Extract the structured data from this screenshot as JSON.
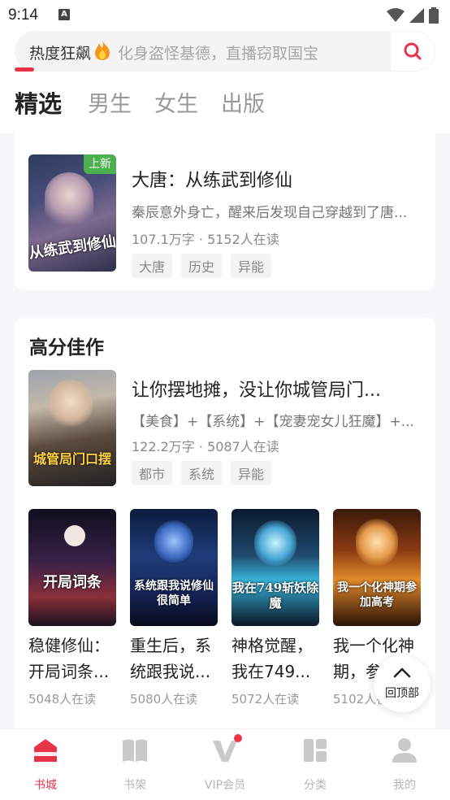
{
  "status": {
    "time": "9:14",
    "notification_letter": "A"
  },
  "search": {
    "hot_label": "热度狂飙",
    "hint": "化身盗怪基德，直播窃取国宝"
  },
  "tabs": [
    {
      "label": "精选",
      "active": true
    },
    {
      "label": "男生",
      "active": false
    },
    {
      "label": "女生",
      "active": false
    },
    {
      "label": "出版",
      "active": false
    }
  ],
  "featured_book": {
    "badge": "上新",
    "cover_text": "从练武到修仙",
    "title": "大唐：从练武到修仙",
    "desc": "秦辰意外身亡，醒来后发现自己穿越到了唐...",
    "meta": "107.1万字 · 5152人在读",
    "tags": [
      "大唐",
      "历史",
      "异能"
    ]
  },
  "high_score": {
    "section_title": "高分佳作",
    "lead_book": {
      "cover_text": "城管局门口摆",
      "title": "让你摆地摊，没让你城管局门...",
      "desc": "【美食】+【系统】+【宠妻宠女儿狂魔】+...",
      "meta": "122.2万字 · 5087人在读",
      "tags": [
        "都市",
        "系统",
        "异能"
      ]
    },
    "grid": [
      {
        "cover_text": "开局词条",
        "title": "稳健修仙：开局词条...",
        "meta": "5048人在读"
      },
      {
        "cover_text": "系统跟我说修仙很简单",
        "title": "重生后，系统跟我说...",
        "meta": "5080人在读"
      },
      {
        "cover_text": "我在749斩妖除魔",
        "title": "神格觉醒，我在749...",
        "meta": "5072人在读"
      },
      {
        "cover_text": "我一个化神期参加高考",
        "title": "我一个化神期，参加...",
        "meta": "5102人在读"
      }
    ]
  },
  "back_to_top": "回顶部",
  "bottom_nav": [
    {
      "label": "书城",
      "icon": "bookstore-icon",
      "active": true
    },
    {
      "label": "书架",
      "icon": "bookshelf-icon",
      "active": false
    },
    {
      "label": "VIP会员",
      "icon": "vip-icon",
      "active": false
    },
    {
      "label": "分类",
      "icon": "category-icon",
      "active": false
    },
    {
      "label": "我的",
      "icon": "profile-icon",
      "active": false
    }
  ],
  "colors": {
    "accent": "#e8334a",
    "badge_green": "#4caf50"
  }
}
